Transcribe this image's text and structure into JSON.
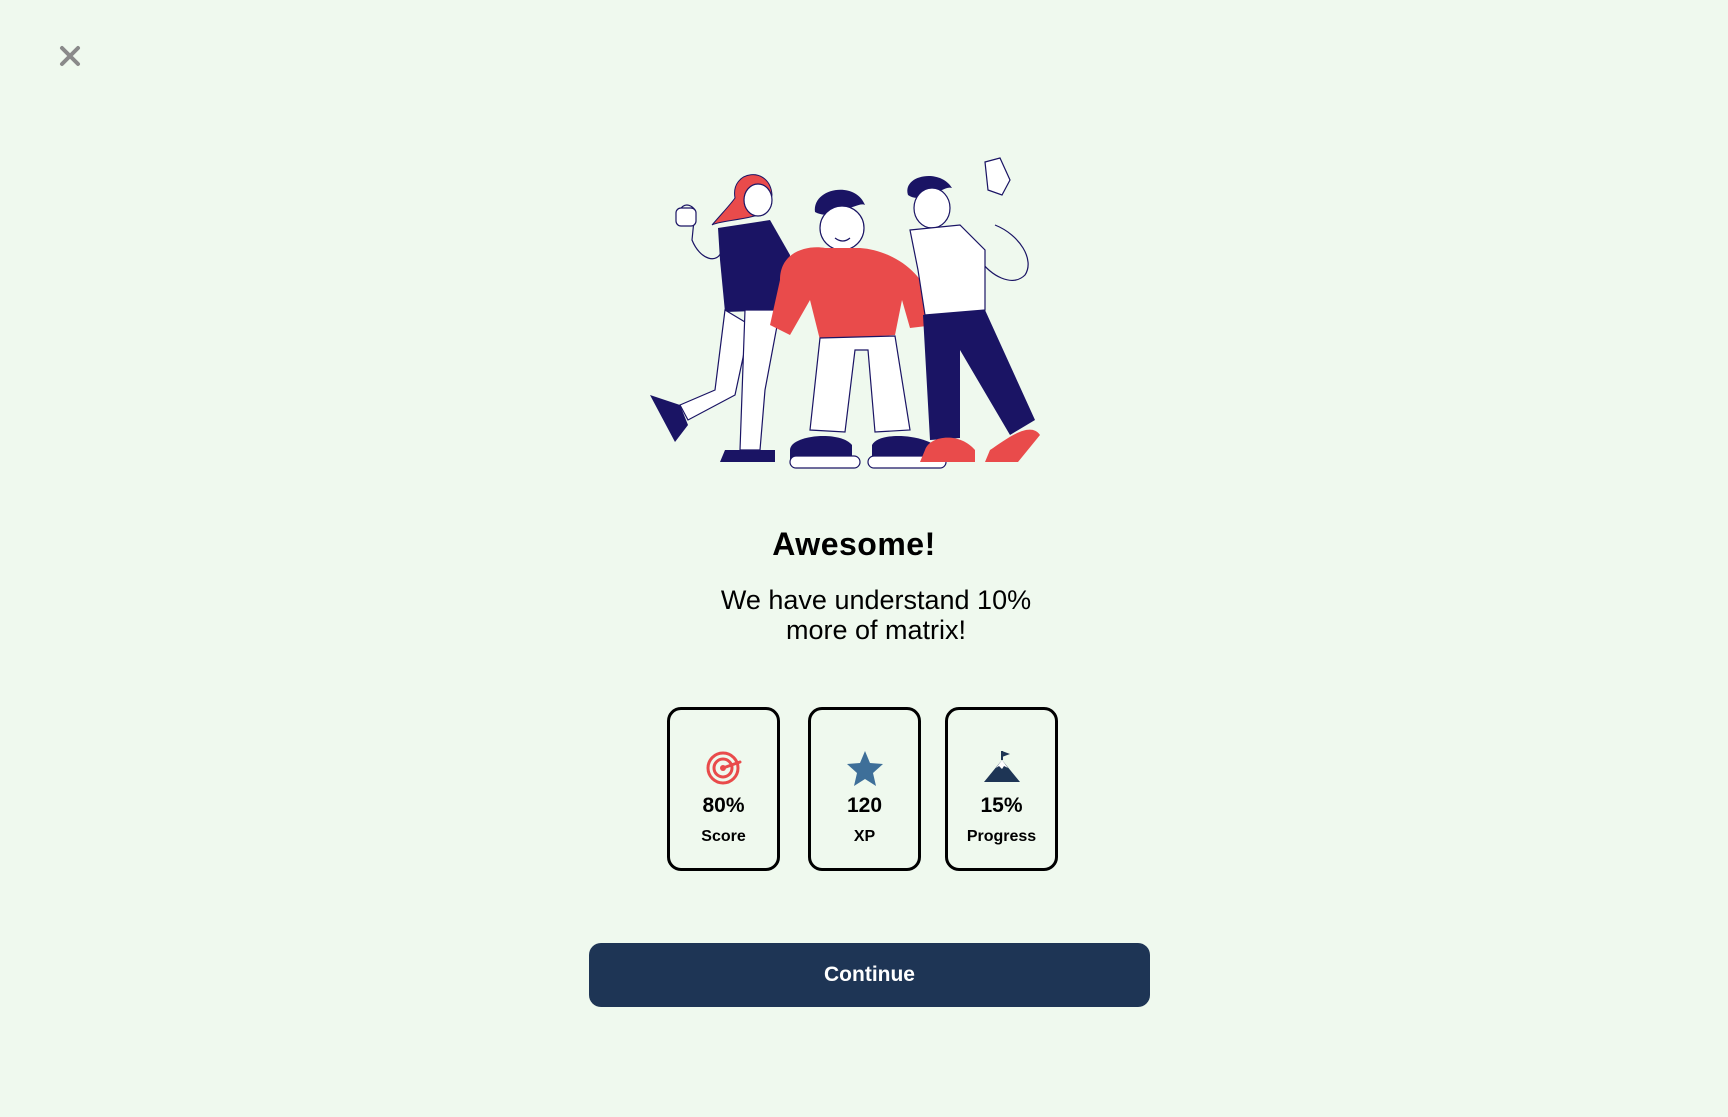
{
  "header": {
    "close_icon": "close-icon"
  },
  "hero": {
    "illustration": "three-friends-celebrating-illustration",
    "title": "Awesome!",
    "subtitle_line1": "We have understand 10%",
    "subtitle_line2": "more of matrix!"
  },
  "stats": [
    {
      "icon": "target-icon",
      "value": "80%",
      "label": "Score",
      "icon_color": "#e94b4b"
    },
    {
      "icon": "star-icon",
      "value": "120",
      "label": "XP",
      "icon_color": "#3e6f99"
    },
    {
      "icon": "mountain-flag-icon",
      "value": "15%",
      "label": "Progress",
      "icon_color": "#1e3555"
    }
  ],
  "actions": {
    "continue_label": "Continue"
  },
  "colors": {
    "background": "#eff9ee",
    "primary": "#1e3555",
    "accent_red": "#e94b4b",
    "navy": "#1a1464"
  }
}
